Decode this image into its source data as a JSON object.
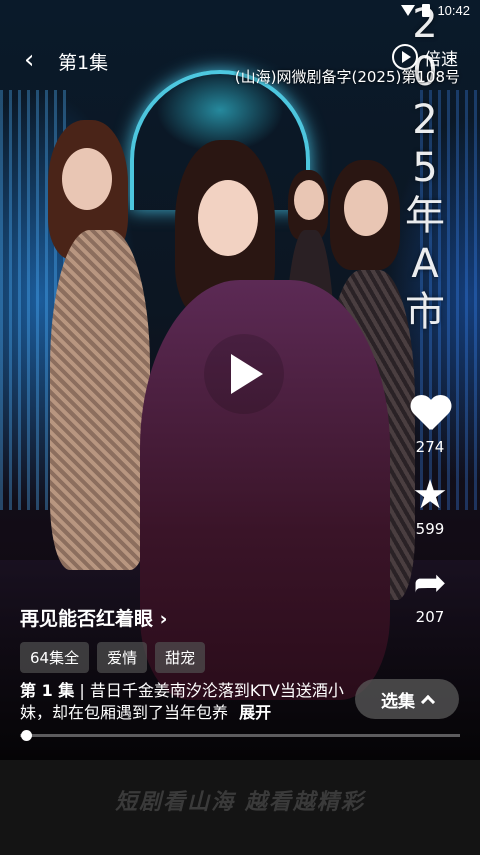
{
  "status_bar": {
    "time": "10:42"
  },
  "header": {
    "episode_title": "第1集",
    "speed_label": "倍速",
    "license_text": "(山海)网微剧备字(2025)第108号"
  },
  "overlay": {
    "vertical_text": [
      "2",
      "0",
      "2",
      "5",
      "年",
      "A",
      "市"
    ]
  },
  "actions": {
    "likes": "274",
    "favorites": "599",
    "shares": "207"
  },
  "info": {
    "series_title": "再见能否红着眼",
    "tags": [
      "64集全",
      "爱情",
      "甜宠"
    ],
    "episode_label": "第 1 集",
    "description": "昔日千金姜南汐沦落到KTV当送酒小妹，却在包厢遇到了当年包养",
    "expand_label": "展开",
    "select_label": "选集"
  },
  "playback": {
    "progress": 0.0
  },
  "footer": {
    "slogan": "短剧看山海 越看越精彩"
  }
}
